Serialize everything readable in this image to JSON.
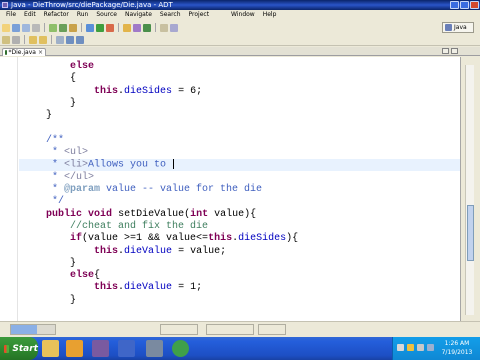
{
  "window": {
    "title": "Java - DieThrow/src/diePackage/Die.java - ADT"
  },
  "menu": [
    "File",
    "Edit",
    "Refactor",
    "Run",
    "Source",
    "Navigate",
    "Search",
    "Project",
    "",
    "Window",
    "Help"
  ],
  "perspective": {
    "label": "Java"
  },
  "editor_tab": {
    "label": "*Die.java",
    "close": "×"
  },
  "code": {
    "lines": [
      {
        "text": "        else",
        "caret": false
      },
      {
        "text": "        {",
        "caret": false
      },
      {
        "text": "            this.dieSides = 6;",
        "caret": false
      },
      {
        "text": "        }",
        "caret": false
      },
      {
        "text": "    }",
        "caret": false
      },
      {
        "text": "",
        "caret": false
      },
      {
        "text": "    /**",
        "caret": false
      },
      {
        "text": "     * <ul>",
        "caret": false
      },
      {
        "text": "     * <li>Allows you to ",
        "caret": true
      },
      {
        "text": "     * </ul>",
        "caret": false
      },
      {
        "text": "     * @param value -- value for the die",
        "caret": false
      },
      {
        "text": "     */",
        "caret": false
      },
      {
        "text": "    public void setDieValue(int value){",
        "caret": false
      },
      {
        "text": "        //cheat and fix the die",
        "caret": false
      },
      {
        "text": "        if(value >=1 && value<=this.dieSides){",
        "caret": false
      },
      {
        "text": "            this.dieValue = value;",
        "caret": false
      },
      {
        "text": "        }",
        "caret": false
      },
      {
        "text": "        else{",
        "caret": false
      },
      {
        "text": "            this.dieValue = 1;",
        "caret": false
      },
      {
        "text": "        }",
        "caret": false
      }
    ]
  },
  "status": {
    "heap": "",
    "heap_used": 0.6,
    "writable": "",
    "insert_mode": "",
    "position": ""
  },
  "taskbar": {
    "start_label": "Start",
    "time": "1:26 AM",
    "date": "7/19/2013"
  }
}
